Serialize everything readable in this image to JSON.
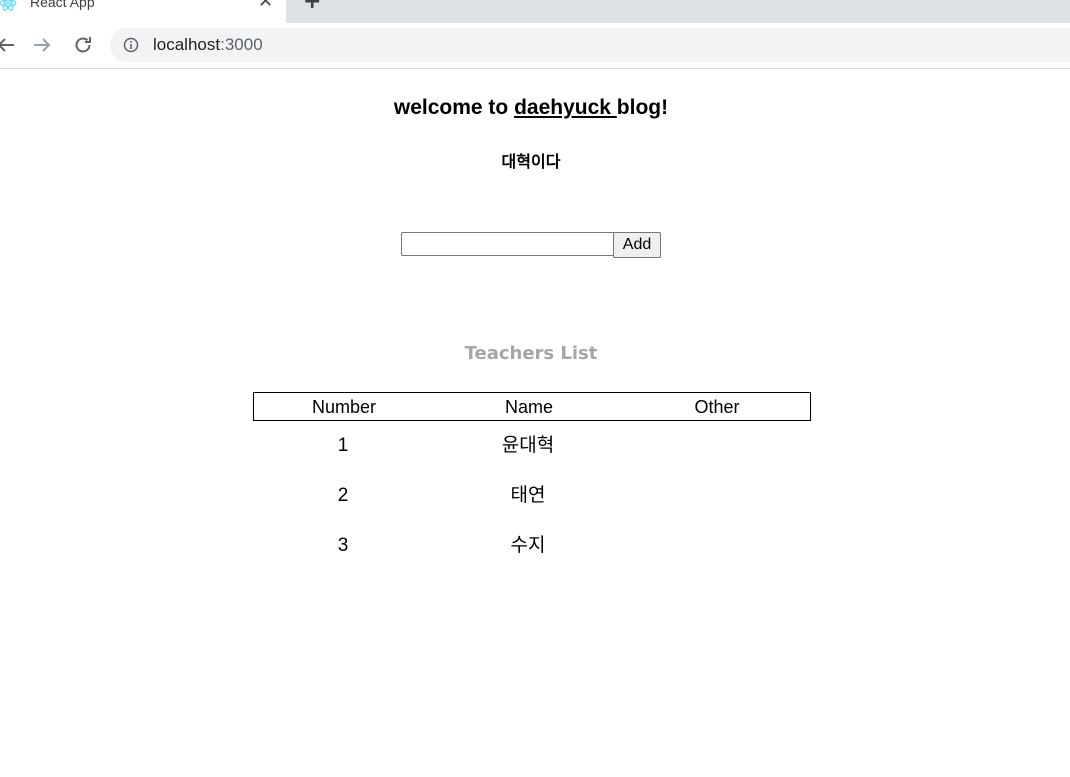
{
  "browser": {
    "tab_title": "React App",
    "tab_close": "✕",
    "new_tab": "+",
    "url_host": "localhost",
    "url_port": ":3000"
  },
  "page": {
    "title_prefix": "welcome to ",
    "title_link": "daehyuck ",
    "title_suffix": "blog!",
    "subtitle": "대혁이다",
    "input_value": "",
    "add_button": "Add",
    "list_title": "Teachers List",
    "table": {
      "headers": [
        "Number",
        "Name",
        "Other"
      ],
      "rows": [
        {
          "number": "1",
          "name": "윤대혁",
          "other": ""
        },
        {
          "number": "2",
          "name": "태연",
          "other": ""
        },
        {
          "number": "3",
          "name": "수지",
          "other": ""
        }
      ]
    }
  }
}
